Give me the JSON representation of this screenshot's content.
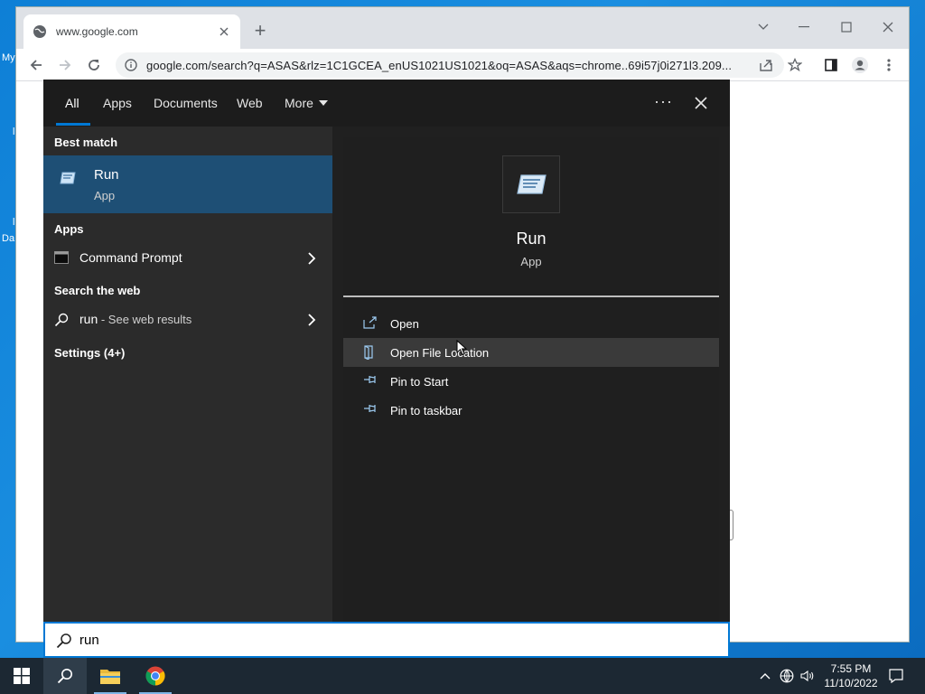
{
  "desktop": {
    "labels": [
      "My",
      "Da"
    ]
  },
  "browser": {
    "tab_title": "www.google.com",
    "url": "google.com/search?q=ASAS&rlz=1C1GCEA_enUS1021US1021&oq=ASAS&aqs=chrome..69i57j0i271l3.209..."
  },
  "search_panel": {
    "tabs": [
      {
        "label": "All",
        "active": true
      },
      {
        "label": "Apps"
      },
      {
        "label": "Documents"
      },
      {
        "label": "Web"
      },
      {
        "label": "More"
      }
    ],
    "best_match_heading": "Best match",
    "best_match": {
      "name": "Run",
      "type": "App"
    },
    "apps_heading": "Apps",
    "apps": [
      {
        "label": "Command Prompt"
      }
    ],
    "web_heading": "Search the web",
    "web_result": {
      "query": "run",
      "suffix": " - See web results"
    },
    "settings_heading": "Settings (4+)",
    "preview": {
      "name": "Run",
      "type": "App",
      "actions": [
        {
          "label": "Open",
          "icon": "open-icon"
        },
        {
          "label": "Open File Location",
          "icon": "file-location-icon",
          "hovered": true
        },
        {
          "label": "Pin to Start",
          "icon": "pin-icon"
        },
        {
          "label": "Pin to taskbar",
          "icon": "pin-icon"
        }
      ]
    },
    "search_value": "run"
  },
  "taskbar": {
    "time": "7:55 PM",
    "date": "11/10/2022",
    "pinned": [
      "start-icon",
      "search-icon",
      "file-explorer-icon",
      "chrome-icon"
    ]
  },
  "colors": {
    "accent": "#0078d4",
    "best_match_bg": "#1e4f75",
    "panel_bg": "#202020",
    "taskbar_bg": "#1c2833"
  }
}
